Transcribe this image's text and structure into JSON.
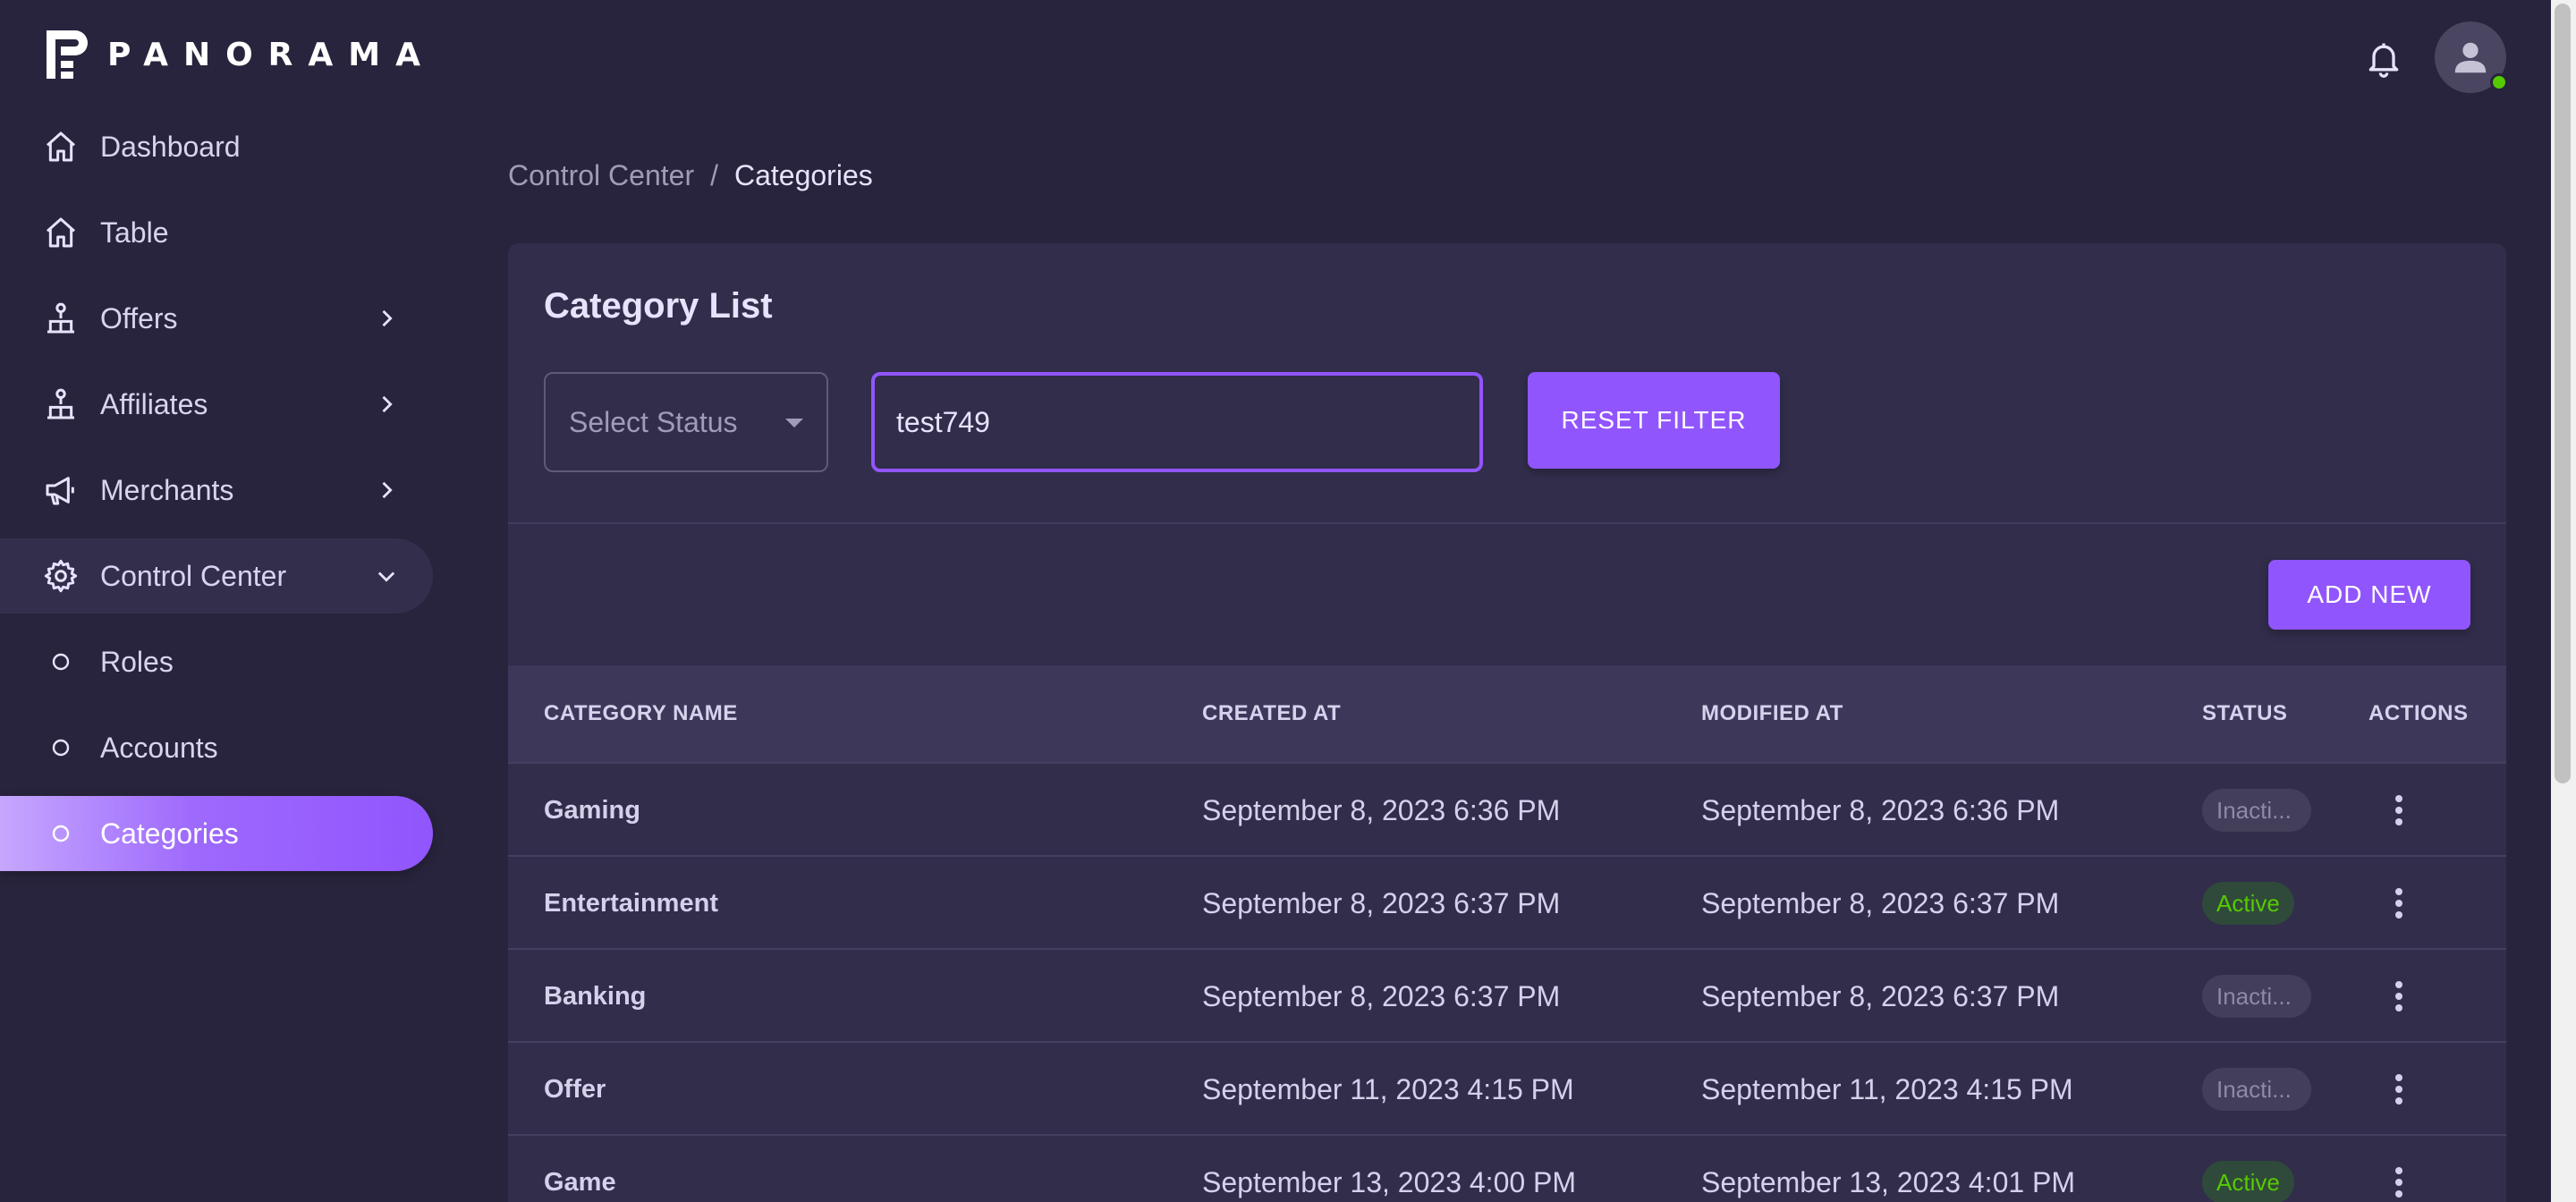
{
  "brand": {
    "name": "PANORAMA"
  },
  "sidebar": {
    "items": [
      {
        "label": "Dashboard",
        "icon": "home-icon"
      },
      {
        "label": "Table",
        "icon": "home-icon"
      },
      {
        "label": "Offers",
        "icon": "org-icon"
      },
      {
        "label": "Affiliates",
        "icon": "org-icon"
      },
      {
        "label": "Merchants",
        "icon": "megaphone-icon"
      },
      {
        "label": "Control Center",
        "icon": "gear-icon"
      },
      {
        "label": "Roles",
        "icon": "circle-icon"
      },
      {
        "label": "Accounts",
        "icon": "circle-icon"
      },
      {
        "label": "Categories",
        "icon": "circle-icon"
      }
    ]
  },
  "breadcrumb": {
    "parent": "Control Center",
    "separator": "/",
    "current": "Categories"
  },
  "card": {
    "title": "Category List",
    "status_select": {
      "placeholder": "Select Status"
    },
    "search": {
      "value": "test749"
    },
    "reset_label": "RESET FILTER",
    "add_label": "ADD NEW"
  },
  "table": {
    "headers": [
      "CATEGORY NAME",
      "CREATED AT",
      "MODIFIED AT",
      "STATUS",
      "ACTIONS"
    ],
    "rows": [
      {
        "name": "Gaming",
        "created": "September 8, 2023 6:36 PM",
        "modified": "September 8, 2023 6:36 PM",
        "status": "Inacti..."
      },
      {
        "name": "Entertainment",
        "created": "September 8, 2023 6:37 PM",
        "modified": "September 8, 2023 6:37 PM",
        "status": "Active"
      },
      {
        "name": "Banking",
        "created": "September 8, 2023 6:37 PM",
        "modified": "September 8, 2023 6:37 PM",
        "status": "Inacti..."
      },
      {
        "name": "Offer",
        "created": "September 11, 2023 4:15 PM",
        "modified": "September 11, 2023 4:15 PM",
        "status": "Inacti..."
      },
      {
        "name": "Game",
        "created": "September 13, 2023 4:00 PM",
        "modified": "September 13, 2023 4:01 PM",
        "status": "Active"
      }
    ]
  },
  "colors": {
    "background": "#28243d",
    "surface": "#312d4b",
    "accent": "#9155fd",
    "active_status": "#56ca00"
  }
}
